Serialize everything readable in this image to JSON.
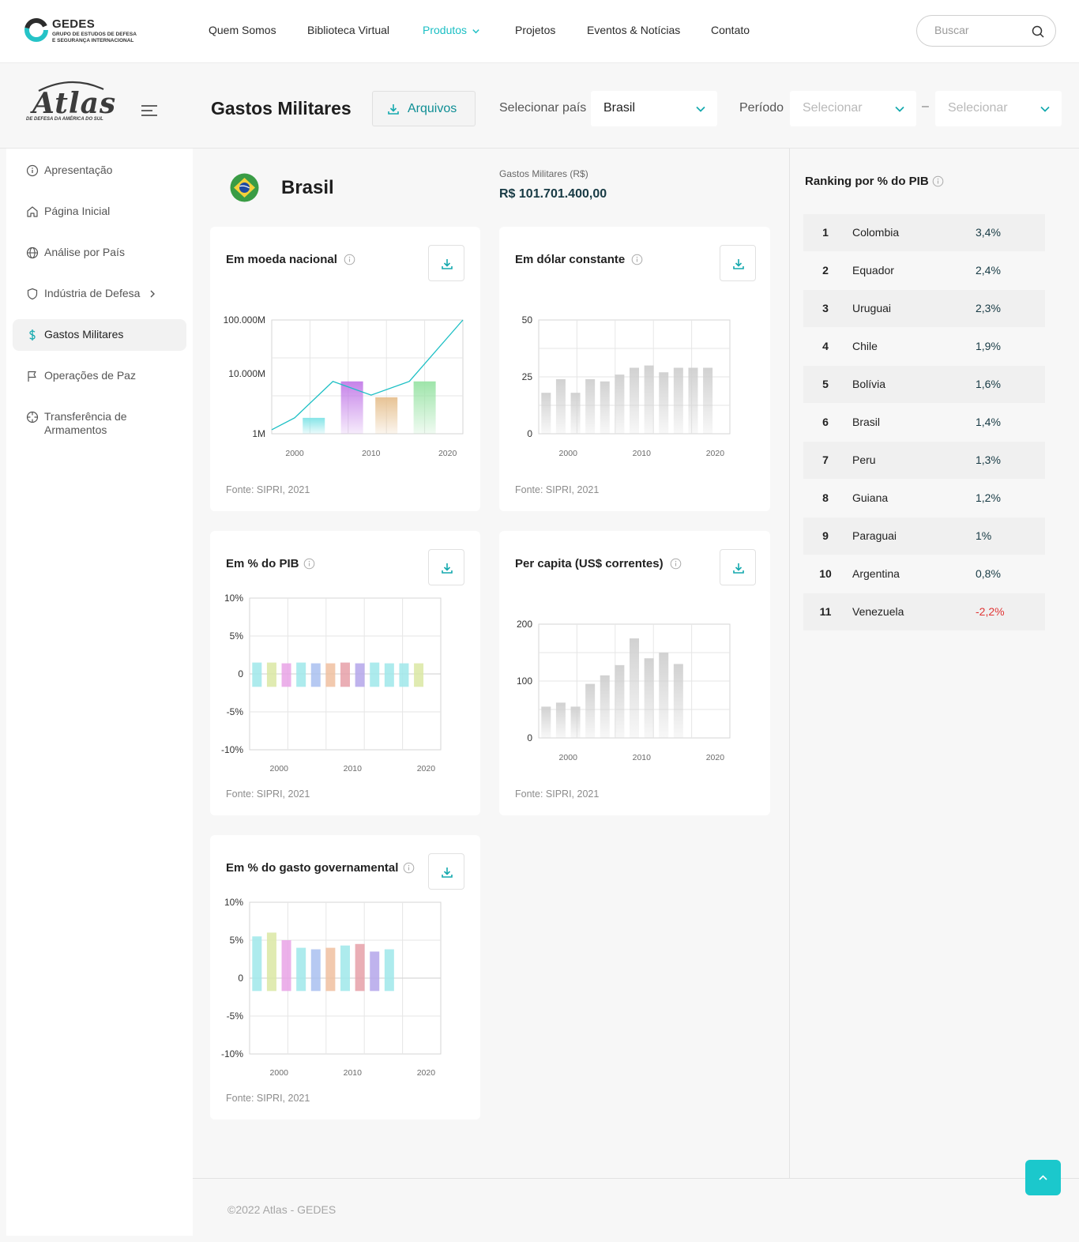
{
  "brand": {
    "name": "GEDES",
    "subtitle_line1": "GRUPO DE ESTUDOS DE DEFESA",
    "subtitle_line2": "E SEGURANÇA INTERNACIONAL",
    "atlas_word": "Atlas",
    "atlas_sub": "DE DEFESA DA AMÉRICA DO SUL"
  },
  "nav": {
    "items": [
      "Quem Somos",
      "Biblioteca Virtual",
      "Produtos",
      "Projetos",
      "Eventos & Notícias",
      "Contato"
    ],
    "active": "Produtos",
    "search_placeholder": "Buscar"
  },
  "header": {
    "title": "Gastos Militares",
    "files_button": "Arquivos",
    "country_label": "Selecionar país",
    "country_value": "Brasil",
    "period_label": "Período",
    "period_from_placeholder": "Selecionar",
    "period_to_placeholder": "Selecionar",
    "period_separator": "–"
  },
  "sidebar": {
    "items": [
      {
        "label": "Apresentação",
        "icon": "info-icon"
      },
      {
        "label": "Página Inicial",
        "icon": "home-icon"
      },
      {
        "label": "Análise por País",
        "icon": "globe-icon"
      },
      {
        "label": "Indústria de Defesa",
        "icon": "shield-icon"
      },
      {
        "label": "Gastos Militares",
        "icon": "dollar-icon"
      },
      {
        "label": "Operações de Paz",
        "icon": "flag-icon"
      },
      {
        "label": "Transferência de Armamentos",
        "icon": "crosshair-icon"
      }
    ],
    "active": "Gastos Militares"
  },
  "summary": {
    "country": "Brasil",
    "metric_label": "Gastos Militares (R$)",
    "metric_value": "R$ 101.701.400,00"
  },
  "cards": [
    {
      "title": "Em moeda nacional",
      "source": "Fonte: SIPRI, 2021"
    },
    {
      "title": "Em dólar constante",
      "source": "Fonte: SIPRI, 2021"
    },
    {
      "title": "Em % do PIB",
      "source": "Fonte: SIPRI, 2021"
    },
    {
      "title": "Per capita (US$ correntes)",
      "source": "Fonte: SIPRI, 2021"
    },
    {
      "title": "Em % do gasto governamental",
      "source": "Fonte: SIPRI, 2021"
    }
  ],
  "chart_data": [
    {
      "type": "bar",
      "title": "Em moeda nacional",
      "scale": "log",
      "yticks": [
        "1M",
        "10.000M",
        "100.000M"
      ],
      "xticks": [
        "2000",
        "2010",
        "2020"
      ],
      "xlim": [
        1997,
        2022
      ],
      "bars": [
        {
          "x": 2002.5,
          "value": 5000,
          "color": "#7fe3e6"
        },
        {
          "x": 2007.5,
          "value": 200000,
          "color": "#c37ce8"
        },
        {
          "x": 2012,
          "value": 40000,
          "color": "#e6c08f"
        },
        {
          "x": 2017,
          "value": 200000,
          "color": "#99e3a5"
        }
      ],
      "line": {
        "x": [
          1997,
          2000,
          2005,
          2010,
          2015,
          2022
        ],
        "values": [
          1500,
          5000,
          200000,
          50000,
          200000,
          100000000
        ],
        "color": "#1bbfc4"
      },
      "grid": true
    },
    {
      "type": "bar",
      "title": "Em dólar constante",
      "ylim": [
        0,
        50
      ],
      "yticks": [
        "0",
        "25",
        "50"
      ],
      "xticks": [
        "2000",
        "2010",
        "2020"
      ],
      "xlim": [
        1996,
        2022
      ],
      "categories": [
        "1997",
        "1999",
        "2001",
        "2003",
        "2005",
        "2007",
        "2009",
        "2011",
        "2013",
        "2015",
        "2017",
        "2019"
      ],
      "values": [
        18,
        24,
        18,
        24,
        23,
        26,
        29,
        30,
        27,
        29,
        29,
        29
      ],
      "color": "#cfcfcf",
      "grid": true
    },
    {
      "type": "bar",
      "title": "Em % do PIB",
      "ylim": [
        -10,
        10
      ],
      "yticks": [
        "10%",
        "5%",
        "0",
        "-5%",
        "-10%"
      ],
      "xticks": [
        "2000",
        "2010",
        "2020"
      ],
      "xlim": [
        1996,
        2022
      ],
      "categories": [
        "1997",
        "1999",
        "2001",
        "2003",
        "2005",
        "2007",
        "2009",
        "2011",
        "2013",
        "2015",
        "2017",
        "2019"
      ],
      "values": [
        1.5,
        1.5,
        1.4,
        1.5,
        1.4,
        1.4,
        1.5,
        1.4,
        1.5,
        1.4,
        1.4,
        1.4
      ],
      "colors": [
        "#9fe8ea",
        "#dbe8a3",
        "#e9a3e6",
        "#9fe8ea",
        "#a9bff0",
        "#f0c0a0",
        "#e6a0a8",
        "#b4a6ea",
        "#9fe8ea",
        "#9fe8ea"
      ],
      "grid": true
    },
    {
      "type": "bar",
      "title": "Per capita (US$ correntes)",
      "ylim": [
        0,
        200
      ],
      "yticks": [
        "0",
        "100",
        "200"
      ],
      "xticks": [
        "2000",
        "2010",
        "2020"
      ],
      "xlim": [
        1996,
        2022
      ],
      "categories": [
        "1997",
        "1999",
        "2001",
        "2003",
        "2005",
        "2007",
        "2009",
        "2011",
        "2013",
        "2015",
        "2017",
        "2019"
      ],
      "values": [
        55,
        62,
        55,
        95,
        110,
        128,
        175,
        140,
        150,
        130
      ],
      "color": "#cfcfcf",
      "grid": true
    },
    {
      "type": "bar",
      "title": "Em % do gasto governamental",
      "ylim": [
        -10,
        10
      ],
      "yticks": [
        "10%",
        "5%",
        "0",
        "-5%",
        "-10%"
      ],
      "xticks": [
        "2000",
        "2010",
        "2020"
      ],
      "xlim": [
        1996,
        2022
      ],
      "categories": [
        "1997",
        "1999",
        "2001",
        "2003",
        "2005",
        "2007",
        "2009",
        "2011",
        "2013",
        "2015"
      ],
      "values": [
        5.5,
        6,
        5,
        4,
        3.8,
        4,
        4.3,
        4.5,
        3.5,
        3.8
      ],
      "colors": [
        "#9fe8ea",
        "#dbe8a3",
        "#e9a3e6",
        "#9fe8ea",
        "#a9bff0",
        "#f0c0a0",
        "#9fe8ea",
        "#e6a0a8",
        "#b4a6ea",
        "#9fe8ea"
      ],
      "grid": true
    }
  ],
  "ranking": {
    "title": "Ranking por % do PIB",
    "rows": [
      {
        "rank": "1",
        "country": "Colombia",
        "value": "3,4%"
      },
      {
        "rank": "2",
        "country": "Equador",
        "value": "2,4%"
      },
      {
        "rank": "3",
        "country": "Uruguai",
        "value": "2,3%"
      },
      {
        "rank": "4",
        "country": "Chile",
        "value": "1,9%"
      },
      {
        "rank": "5",
        "country": "Bolívia",
        "value": "1,6%"
      },
      {
        "rank": "6",
        "country": "Brasil",
        "value": "1,4%"
      },
      {
        "rank": "7",
        "country": "Peru",
        "value": "1,3%"
      },
      {
        "rank": "8",
        "country": "Guiana",
        "value": "1,2%"
      },
      {
        "rank": "9",
        "country": "Paraguai",
        "value": "1%"
      },
      {
        "rank": "10",
        "country": "Argentina",
        "value": "0,8%"
      },
      {
        "rank": "11",
        "country": "Venezuela",
        "value": "-2,2%",
        "negative": true
      }
    ]
  },
  "footer": {
    "copyright": "©2022 Atlas - GEDES"
  },
  "colors": {
    "accent": "#1bbfc4",
    "negative": "#e03535",
    "metric": "#173a44"
  }
}
